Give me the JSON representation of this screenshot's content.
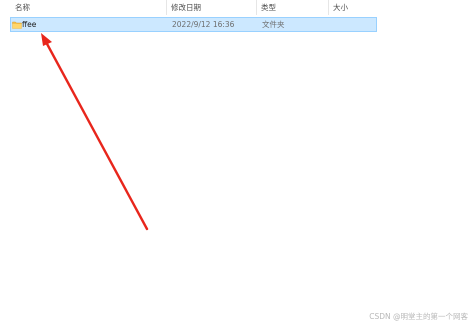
{
  "columns": {
    "name": "名称",
    "date": "修改日期",
    "type": "类型",
    "size": "大小"
  },
  "collapse_icon": "chevron-up-icon",
  "rows": [
    {
      "icon": "folder-icon",
      "name": "ffee",
      "date": "2022/9/12 16:36",
      "type": "文件夹",
      "size": ""
    }
  ],
  "annotation": {
    "icon": "arrow-icon",
    "color": "#e8261c"
  },
  "colors": {
    "selection_fill": "#cce8ff",
    "selection_border": "#99d1ff",
    "folder": "#f5c04a"
  },
  "watermark": "CSDN @明堂主的第一个网客"
}
